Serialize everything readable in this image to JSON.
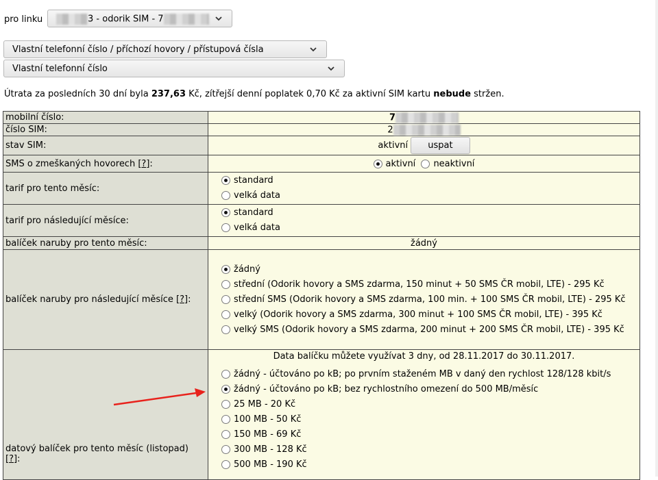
{
  "link_selector": {
    "label": "pro linku",
    "value": "- odorik SIM - 7",
    "value_prefix": "3"
  },
  "nav_select_1": "Vlastní telefonní číslo / příchozí hovory / přístupová čísla",
  "nav_select_2": "Vlastní telefonní číslo",
  "summary": {
    "part1": "Útrata za posledních 30 dní byla ",
    "amount": "237,63",
    "part2": " Kč, zítřejší denní poplatek 0,70 Kč za aktivní SIM kartu ",
    "emph": "nebude",
    "part3": " stržen."
  },
  "rows": {
    "mobile_number": {
      "label": "mobilní číslo:",
      "value": "7"
    },
    "sim_number": {
      "label": "číslo SIM:",
      "value": "2"
    },
    "sim_state": {
      "label": "stav SIM:",
      "value": "aktivní",
      "button": "uspat"
    },
    "missed_sms": {
      "label": "SMS o zmeškaných hovorech [",
      "help": "?",
      "label_end": "]:",
      "opt_on": "aktivní",
      "opt_off": "neaktivní"
    },
    "tariff_this": {
      "label": "tarif pro tento měsíc:",
      "opt1": "standard",
      "opt2": "velká data"
    },
    "tariff_next": {
      "label": "tarif pro následující měsíce:",
      "opt1": "standard",
      "opt2": "velká data"
    },
    "package_this": {
      "label": "balíček naruby pro tento měsíc:",
      "value": "žádný"
    },
    "package_next": {
      "label": "balíček naruby pro následující měsíce [",
      "help": "?",
      "label_end": "]:",
      "options": [
        "žádný",
        "střední (Odorik hovory a SMS zdarma, 150 minut + 50 SMS ČR mobil, LTE) - 295 Kč",
        "střední SMS (Odorik hovory a SMS zdarma, 100 min. + 100 SMS ČR mobil, LTE) - 295 Kč",
        "velký (Odorik hovory a SMS zdarma, 300 minut + 100 SMS ČR mobil, LTE) - 395 Kč",
        "velký SMS (Odorik hovory a SMS zdarma, 200 minut + 200 SMS ČR mobil, LTE) - 395 Kč"
      ]
    },
    "data_this": {
      "label": "datový balíček pro tento měsíc (listopad)",
      "help": "?",
      "label_end": "]:",
      "note": "Data balíčku můžete využívat 3 dny, od 28.11.2017 do 30.11.2017.",
      "options": [
        "žádný - účtováno po kB; po prvním staženém MB v daný den rychlost 128/128 kbit/s",
        "žádný - účtováno po kB; bez rychlostního omezení do 500 MB/měsíc",
        "25 MB - 20 Kč",
        "100 MB - 50 Kč",
        "150 MB - 69 Kč",
        "300 MB - 128 Kč",
        "500 MB - 190 Kč"
      ]
    }
  },
  "colors": {
    "label_bg": "#dedfd4",
    "value_bg": "#fbfbe4",
    "arrow": "#e8221c"
  }
}
